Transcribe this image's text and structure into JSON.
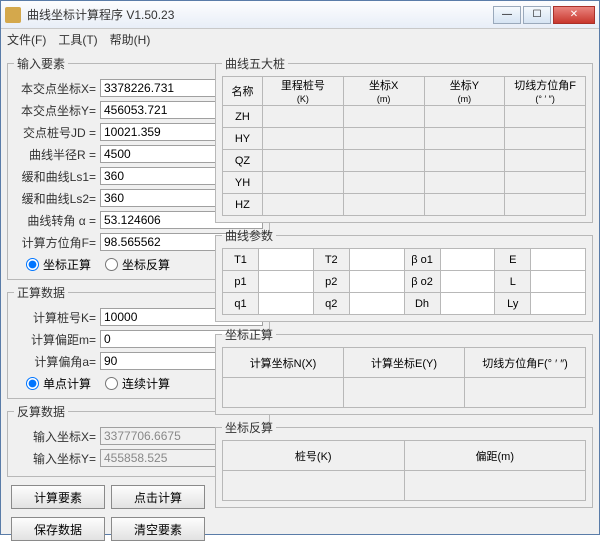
{
  "window": {
    "title": "曲线坐标计算程序 V1.50.23"
  },
  "menubar": {
    "file": "文件(F)",
    "tools": "工具(T)",
    "help": "帮助(H)"
  },
  "input_group": {
    "legend": "输入要素",
    "x_label": "本交点坐标X=",
    "x_val": "3378226.731",
    "y_label": "本交点坐标Y=",
    "y_val": "456053.721",
    "jd_label": "交点桩号JD =",
    "jd_val": "10021.359",
    "r_label": "曲线半径R =",
    "r_val": "4500",
    "ls1_label": "缓和曲线Ls1=",
    "ls1_val": "360",
    "ls2_label": "缓和曲线Ls2=",
    "ls2_val": "360",
    "a_label": "曲线转角 α =",
    "a_val": "53.124606",
    "f_label": "计算方位角F=",
    "f_val": "98.565562",
    "radio_forward": "坐标正算",
    "radio_reverse": "坐标反算"
  },
  "forward_group": {
    "legend": "正算数据",
    "k_label": "计算桩号K=",
    "k_val": "10000",
    "m_label": "计算偏距m=",
    "m_val": "0",
    "a_label": "计算偏角a=",
    "a_val": "90",
    "radio_single": "单点计算",
    "radio_cont": "连续计算"
  },
  "reverse_group": {
    "legend": "反算数据",
    "x_label": "输入坐标X=",
    "x_val": "3377706.6675",
    "y_label": "输入坐标Y=",
    "y_val": "455858.525"
  },
  "buttons": {
    "calc_elem": "计算要素",
    "click_calc": "点击计算",
    "save_data": "保存数据",
    "clear_elem": "清空要素"
  },
  "five_piles": {
    "legend": "曲线五大桩",
    "col_name": "名称",
    "col_mileage": "里程桩号",
    "col_mileage_unit": "(K)",
    "col_x": "坐标X",
    "col_x_unit": "(m)",
    "col_y": "坐标Y",
    "col_y_unit": "(m)",
    "col_f": "切线方位角F",
    "col_f_unit": "(° ′ ″)",
    "rows": [
      "ZH",
      "HY",
      "QZ",
      "YH",
      "HZ"
    ]
  },
  "params": {
    "legend": "曲线参数",
    "labels": [
      "T1",
      "T2",
      "β o1",
      "E",
      "p1",
      "p2",
      "β o2",
      "L",
      "q1",
      "q2",
      "Dh",
      "Ly"
    ]
  },
  "zs": {
    "legend": "坐标正算",
    "col1": "计算坐标N(X)",
    "col2": "计算坐标E(Y)",
    "col3": "切线方位角F(° ′ ″)"
  },
  "fs": {
    "legend": "坐标反算",
    "col1": "桩号(K)",
    "col2": "偏距(m)"
  }
}
